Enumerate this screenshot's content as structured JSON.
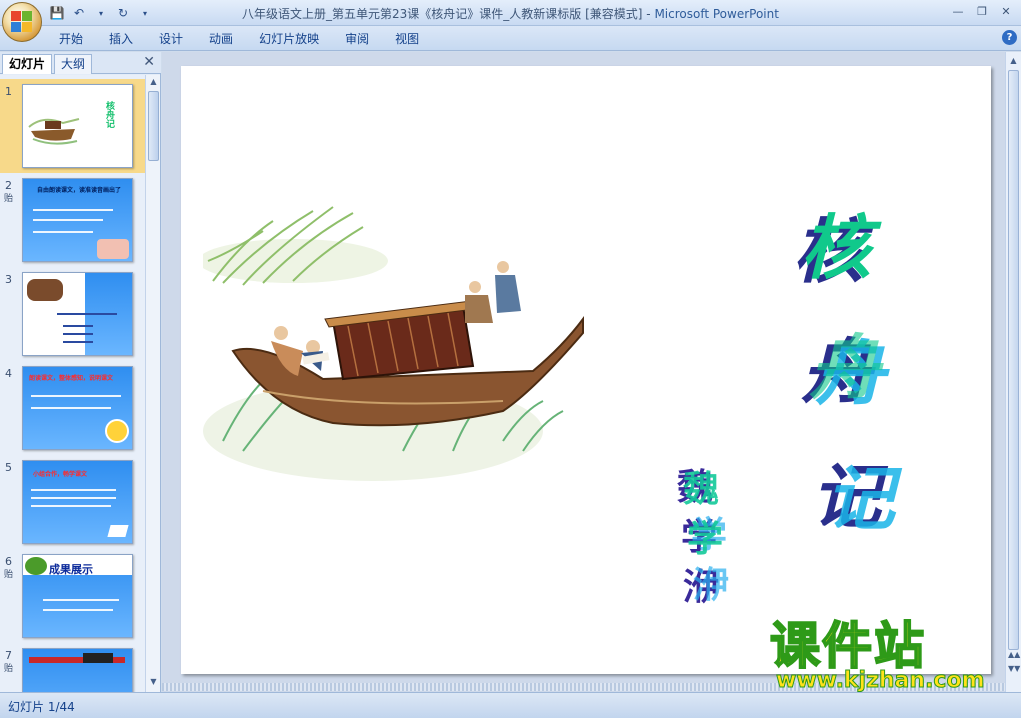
{
  "window": {
    "title_doc": "八年级语文上册_第五单元第23课《核舟记》课件_人教新课标版 [兼容模式]",
    "title_sep": " - ",
    "title_app": "Microsoft PowerPoint"
  },
  "ribbon": {
    "tabs": [
      "开始",
      "插入",
      "设计",
      "动画",
      "幻灯片放映",
      "审阅",
      "视图"
    ]
  },
  "left_pane": {
    "tabs": [
      "幻灯片",
      "大纲"
    ],
    "active_tab": "幻灯片",
    "slides": [
      {
        "num": "1",
        "anim": ""
      },
      {
        "num": "2",
        "anim": "贻"
      },
      {
        "num": "3",
        "anim": ""
      },
      {
        "num": "4",
        "anim": ""
      },
      {
        "num": "5",
        "anim": ""
      },
      {
        "num": "6",
        "anim": "贻"
      },
      {
        "num": "7",
        "anim": "贻"
      }
    ],
    "thumb_texts": {
      "t1_title": "核舟记",
      "t2_title": "自由朗读课文，读准读音画出了",
      "t4_title": "朗读课文，整体感知，说明课文",
      "t5_title": "小组合作，畅学课文",
      "t6_title": "成果展示"
    }
  },
  "slide": {
    "title_chars": [
      "核",
      "舟",
      "记"
    ],
    "author_chars": [
      "魏",
      "学",
      "洢"
    ]
  },
  "watermark": {
    "brand": "课件站",
    "url": "www.kjzhan.com"
  },
  "status": {
    "slide_counter": "幻灯片 1/44"
  },
  "colors": {
    "accent": "#15428b",
    "selected_thumb": "#f7d98a",
    "title_dark": "#2a2f8c",
    "title_green": "#10c98b",
    "title_cyan": "#1ab4e8"
  }
}
